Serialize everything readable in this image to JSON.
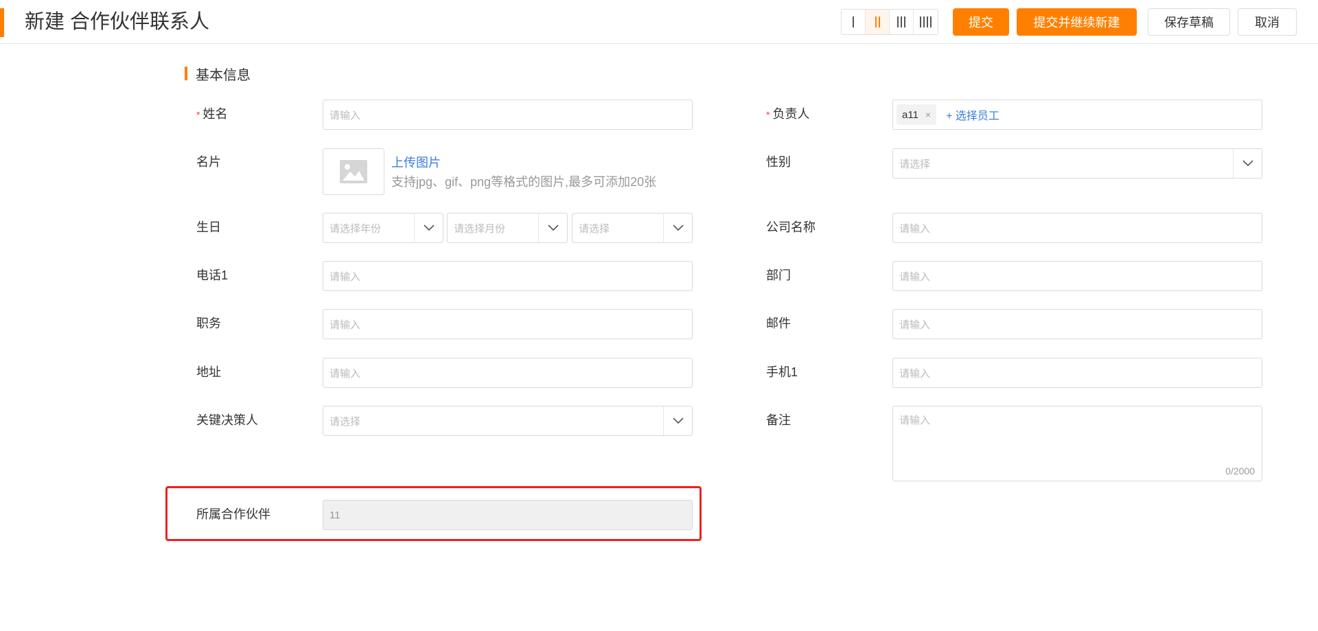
{
  "header": {
    "title": "新建 合作伙伴联系人",
    "buttons": {
      "submit": "提交",
      "submit_new": "提交并继续新建",
      "save_draft": "保存草稿",
      "cancel": "取消"
    }
  },
  "section": {
    "title": "基本信息"
  },
  "fields": {
    "name": {
      "label": "姓名",
      "required_mark": "*",
      "placeholder": "请输入"
    },
    "owner": {
      "label": "负责人",
      "required_mark": "*",
      "tag": "a11",
      "tag_close": "×",
      "add_label": "+ 选择员工"
    },
    "card": {
      "label": "名片",
      "upload_label": "上传图片",
      "hint": "支持jpg、gif、png等格式的图片,最多可添加20张"
    },
    "gender": {
      "label": "性别",
      "placeholder": "请选择"
    },
    "birthday": {
      "label": "生日",
      "year_placeholder": "请选择年份",
      "month_placeholder": "请选择月份",
      "day_placeholder": "请选择"
    },
    "company": {
      "label": "公司名称",
      "placeholder": "请输入"
    },
    "phone": {
      "label": "电话1",
      "placeholder": "请输入"
    },
    "department": {
      "label": "部门",
      "placeholder": "请输入"
    },
    "position": {
      "label": "职务",
      "placeholder": "请输入"
    },
    "email": {
      "label": "邮件",
      "placeholder": "请输入"
    },
    "address": {
      "label": "地址",
      "placeholder": "请输入"
    },
    "mobile": {
      "label": "手机1",
      "placeholder": "请输入"
    },
    "decision_maker": {
      "label": "关键决策人",
      "placeholder": "请选择"
    },
    "remark": {
      "label": "备注",
      "placeholder": "请输入",
      "counter": "0/2000"
    },
    "partner": {
      "label": "所属合作伙伴",
      "value": "11"
    }
  },
  "colors": {
    "accent": "#ff8000",
    "link": "#3b7ddd",
    "required": "#f04134",
    "highlight": "#f02020"
  }
}
